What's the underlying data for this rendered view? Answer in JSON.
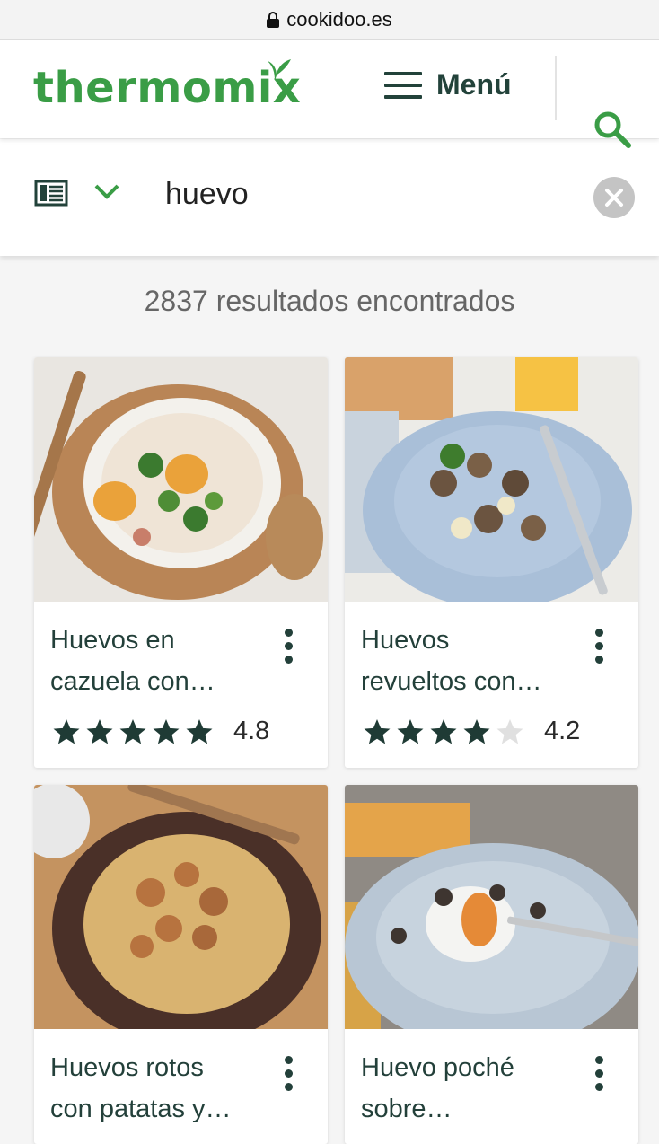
{
  "browser": {
    "url": "cookidoo.es"
  },
  "header": {
    "logo_text": "thermomix",
    "menu_label": "Menú"
  },
  "search": {
    "query": "huevo"
  },
  "results": {
    "count_text": "2837 resultados encontrados"
  },
  "colors": {
    "brand_green": "#3a9d46",
    "dark_green": "#22423a",
    "star_filled": "#1f3b35",
    "star_empty": "#e0e0e0"
  },
  "recipes": [
    {
      "title_line1": "Huevos en",
      "title_line2": "cazuela con…",
      "rating": "4.8",
      "stars": 5,
      "image": "huevos-en-cazuela-photo"
    },
    {
      "title_line1": "Huevos",
      "title_line2": "revueltos con…",
      "rating": "4.2",
      "stars": 4,
      "image": "huevos-revueltos-photo"
    },
    {
      "title_line1": "Huevos rotos",
      "title_line2": "con patatas y…",
      "image": "huevos-rotos-photo"
    },
    {
      "title_line1": "Huevo poché",
      "title_line2": "sobre…",
      "image": "huevo-poche-photo"
    }
  ]
}
